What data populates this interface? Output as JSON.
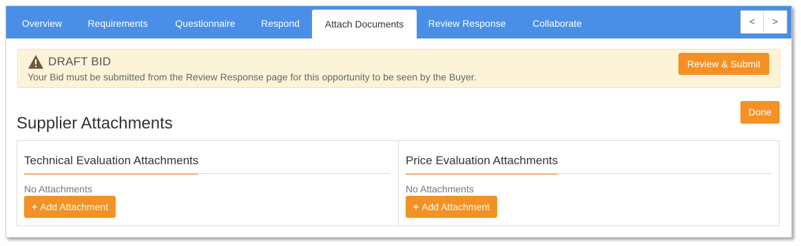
{
  "tabs": [
    {
      "label": "Overview",
      "active": false
    },
    {
      "label": "Requirements",
      "active": false
    },
    {
      "label": "Questionnaire",
      "active": false
    },
    {
      "label": "Respond",
      "active": false
    },
    {
      "label": "Attach Documents",
      "active": true
    },
    {
      "label": "Review Response",
      "active": false
    },
    {
      "label": "Collaborate",
      "active": false
    }
  ],
  "pager": {
    "prev": "<",
    "next": ">"
  },
  "banner": {
    "icon": "warning-triangle-icon",
    "title": "DRAFT BID",
    "message": "Your Bid must be submitted from the Review Response page for this opportunity to be seen by the Buyer.",
    "action": "Review & Submit"
  },
  "done_label": "Done",
  "section_title": "Supplier Attachments",
  "panels": [
    {
      "title": "Technical Evaluation Attachments",
      "empty_text": "No Attachments",
      "add_label": "Add Attachment",
      "add_icon": "plus-icon"
    },
    {
      "title": "Price Evaluation Attachments",
      "empty_text": "No Attachments",
      "add_label": "Add Attachment",
      "add_icon": "plus-icon"
    }
  ],
  "colors": {
    "tabbar": "#4a8fe7",
    "accent": "#f39125",
    "banner_bg": "#fcf3d8"
  }
}
